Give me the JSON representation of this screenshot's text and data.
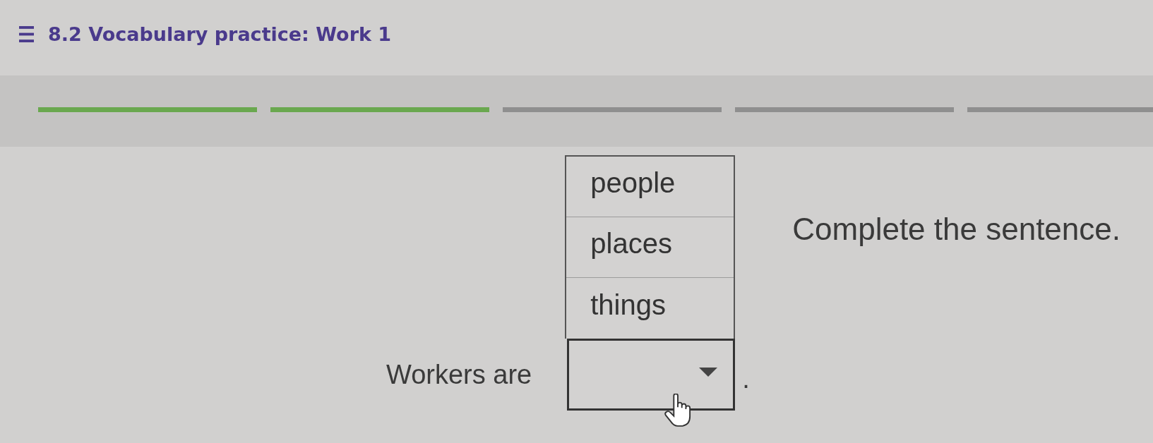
{
  "header": {
    "title": "8.2 Vocabulary practice: Work 1"
  },
  "progress": {
    "segments": [
      {
        "completed": true
      },
      {
        "completed": true
      },
      {
        "completed": false
      },
      {
        "completed": false
      },
      {
        "completed": false
      }
    ]
  },
  "instruction": "Complete the sentence.",
  "sentence": {
    "before": "Workers are",
    "after": ".",
    "dropdown": {
      "expanded": true,
      "options": [
        {
          "label": "people",
          "selected": false
        },
        {
          "label": "places",
          "selected": false
        },
        {
          "label": "things",
          "selected": false
        }
      ]
    }
  }
}
